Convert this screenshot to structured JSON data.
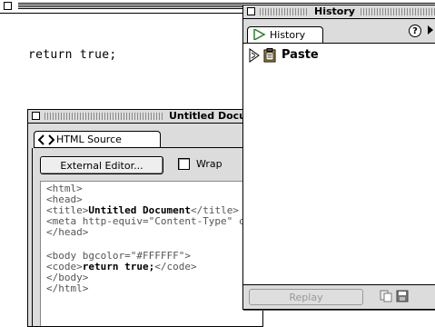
{
  "document": {
    "code_text": "return true;"
  },
  "source_panel": {
    "title": "Untitled Document",
    "tab_label": "HTML Source",
    "tab_icon": "code-brackets-icon",
    "external_editor_label": "External Editor...",
    "wrap_label": "Wrap",
    "wrap_checked": false,
    "code_lines": [
      "<html>",
      "<head>",
      "<title>Untitled Document</title>",
      "<meta http-equiv=\"Content-Type\" content=\"text/html\">",
      "</head>",
      "",
      "<body bgcolor=\"#FFFFFF\">",
      "<code>return true;</code>",
      "</body>",
      "</html>"
    ]
  },
  "history_panel": {
    "title": "History",
    "tab_label": "History",
    "tab_icon": "play-arrow-icon",
    "help_icon": "help-icon",
    "items": [
      {
        "label": "Paste",
        "icon": "paste-clipboard-icon"
      }
    ],
    "replay_label": "Replay",
    "footer_icons": [
      "copy-steps-icon",
      "save-command-icon"
    ]
  },
  "colors": {
    "panel_gray": "#dcdcdc",
    "text": "#000000"
  }
}
